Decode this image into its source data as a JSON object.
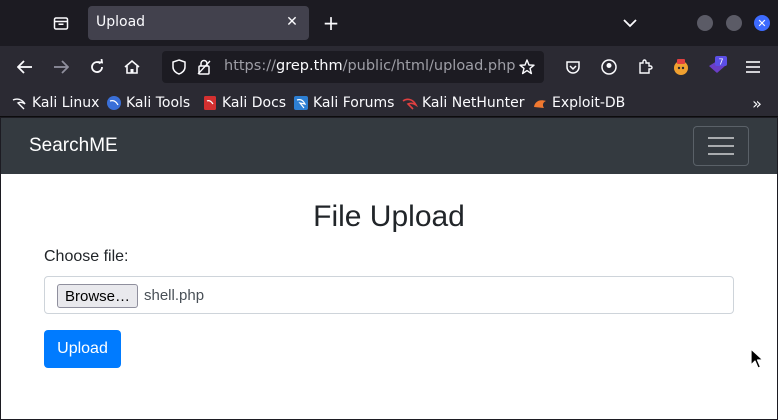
{
  "browser": {
    "tab": {
      "title": "Upload"
    },
    "url": {
      "scheme": "https://",
      "host": "grep.thm",
      "path": "/public/html/upload.php"
    },
    "extension_badge": "7",
    "bookmarks": [
      {
        "label": "Kali Linux",
        "icon": "kali-icon"
      },
      {
        "label": "Kali Tools",
        "icon": "kali-tools-icon"
      },
      {
        "label": "Kali Docs",
        "icon": "kali-docs-icon"
      },
      {
        "label": "Kali Forums",
        "icon": "kali-forums-icon"
      },
      {
        "label": "Kali NetHunter",
        "icon": "nethunter-icon"
      },
      {
        "label": "Exploit-DB",
        "icon": "exploit-db-icon"
      }
    ]
  },
  "site": {
    "brand": "SearchME",
    "heading": "File Upload",
    "file_label": "Choose file:",
    "browse_label": "Browse…",
    "file_name": "shell.php",
    "upload_label": "Upload"
  },
  "colors": {
    "primary_button": "#007bff",
    "site_nav": "#343a40",
    "browser_chrome": "#2b2a33"
  }
}
